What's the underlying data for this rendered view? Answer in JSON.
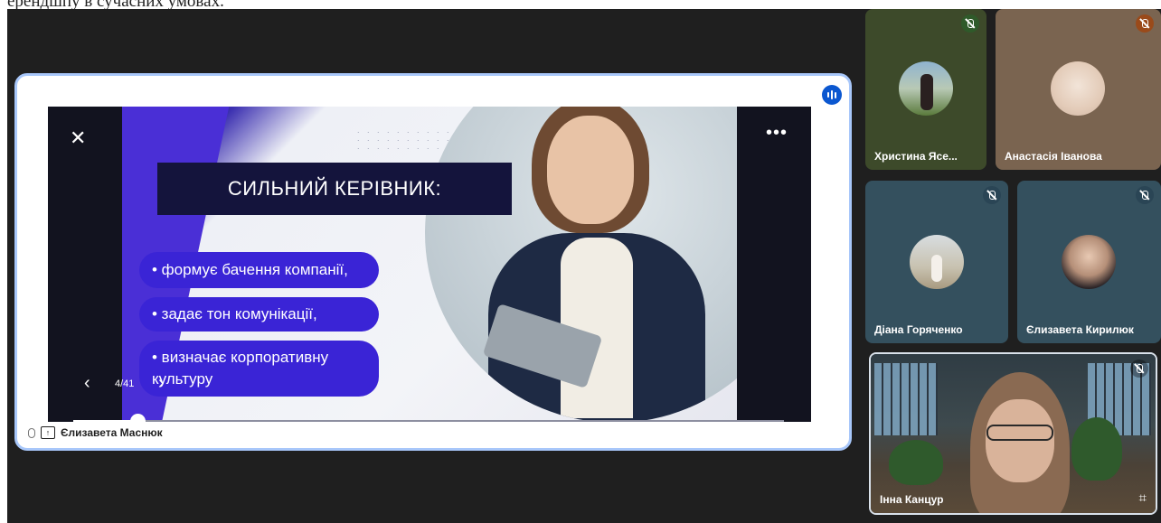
{
  "doc_snippet": "ерендшпу в сучасних умовах.",
  "presentation": {
    "slide_title": "СИЛЬНИЙ КЕРІВНИК:",
    "bullets": [
      "• формує бачення компанії,",
      "• задає тон комунікації,",
      "• визначає корпоративну культуру"
    ],
    "counter": "4/41",
    "progress": 0.09,
    "presenter_name": "Єлизавета Маснюк",
    "icons": {
      "close": "close-icon",
      "more": "more-options-icon",
      "prev": "chevron-left-icon",
      "next": "chevron-right-icon",
      "speaking": "audio-level-icon",
      "present": "present-screen-icon"
    }
  },
  "participants": [
    {
      "name": "Христина Ясе...",
      "muted": true,
      "color": "#3d4a2a"
    },
    {
      "name": "Анастасія Іванова",
      "muted": true,
      "color": "#7a6450"
    },
    {
      "name": "Діана Горяченко",
      "muted": true,
      "color": "#34505e"
    },
    {
      "name": "Єлизавета Кирилюк",
      "muted": true,
      "color": "#34505e"
    },
    {
      "name": "Інна Канцур",
      "muted": true,
      "video": true
    }
  ],
  "colors": {
    "meet_background": "#1f1f1f",
    "accent_blue": "#a8c7fa",
    "slide_purple": "#3a24d6",
    "slide_title_bg": "#14143c"
  }
}
